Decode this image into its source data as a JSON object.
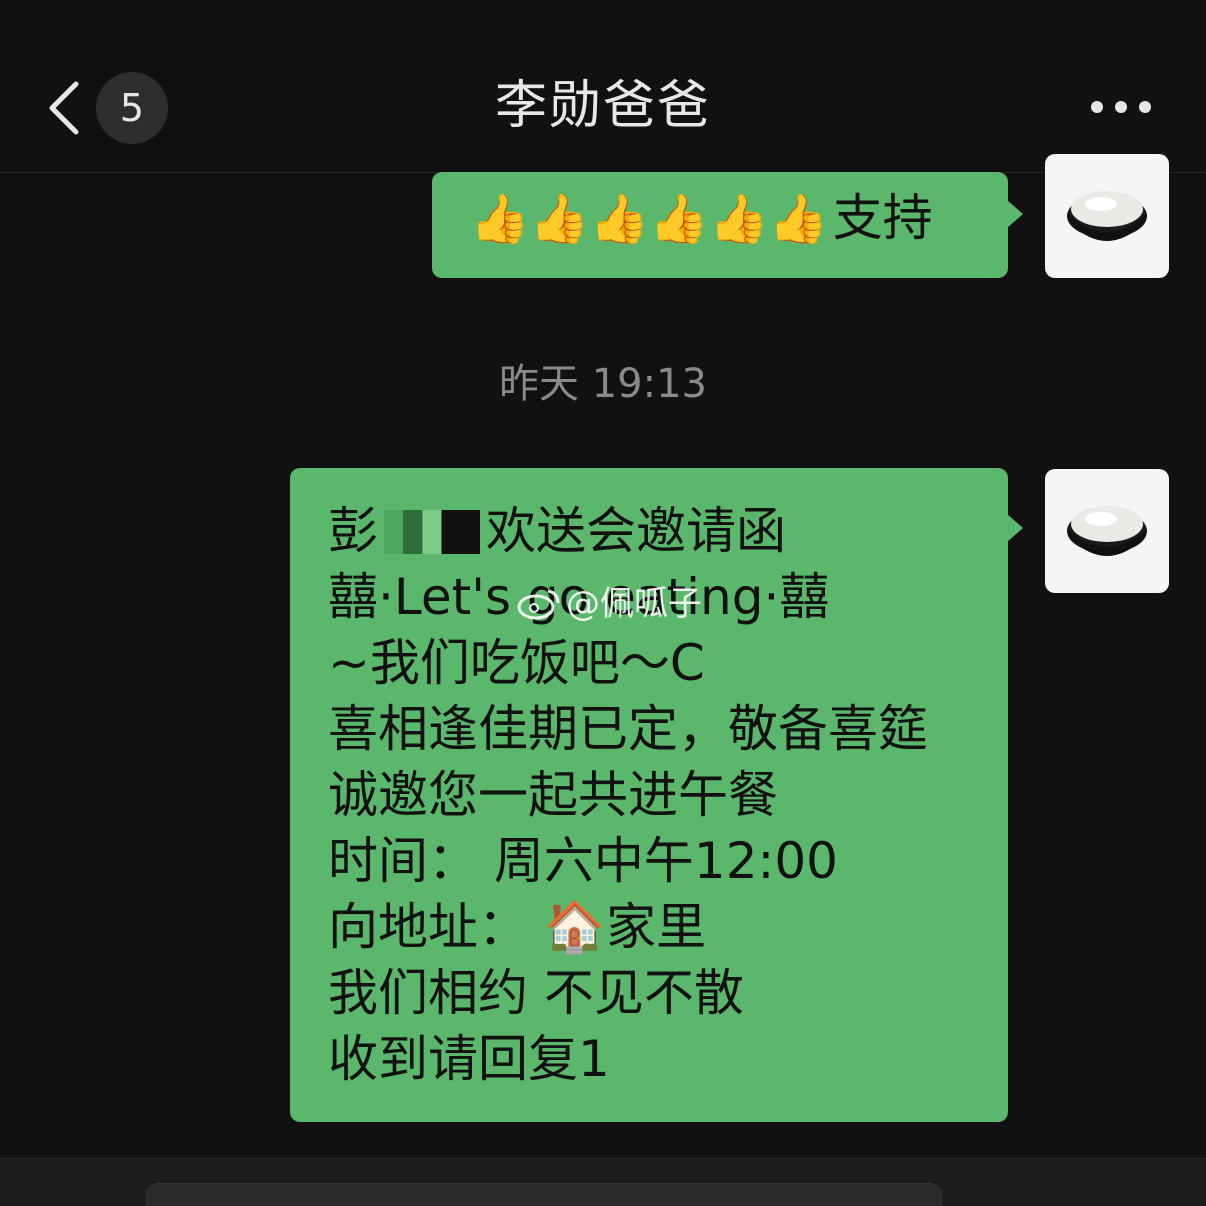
{
  "header": {
    "unread_count": "5",
    "title": "李勋爸爸"
  },
  "messages": [
    {
      "emoji": "👍👍👍👍👍👍",
      "text": "支持"
    }
  ],
  "timestamp": "昨天 19:13",
  "invitation": {
    "line1_prefix": "彭",
    "line1_suffix": "欢送会邀请函",
    "lines": [
      "囍·Let's go eating·囍",
      "~我们吃饭吧～C",
      "喜相逢佳期已定，敬备喜筵",
      "诚邀您一起共进午餐",
      "时间：  周六中午12:00",
      "向地址：  🏠家里",
      "我们相约 不见不散",
      "收到请回复1"
    ]
  },
  "watermark": "@佩呱子",
  "colors": {
    "background": "#111111",
    "bubble": "#5bb76b",
    "header_text": "#e8e8e8",
    "timestamp_text": "#8a8a8a"
  }
}
